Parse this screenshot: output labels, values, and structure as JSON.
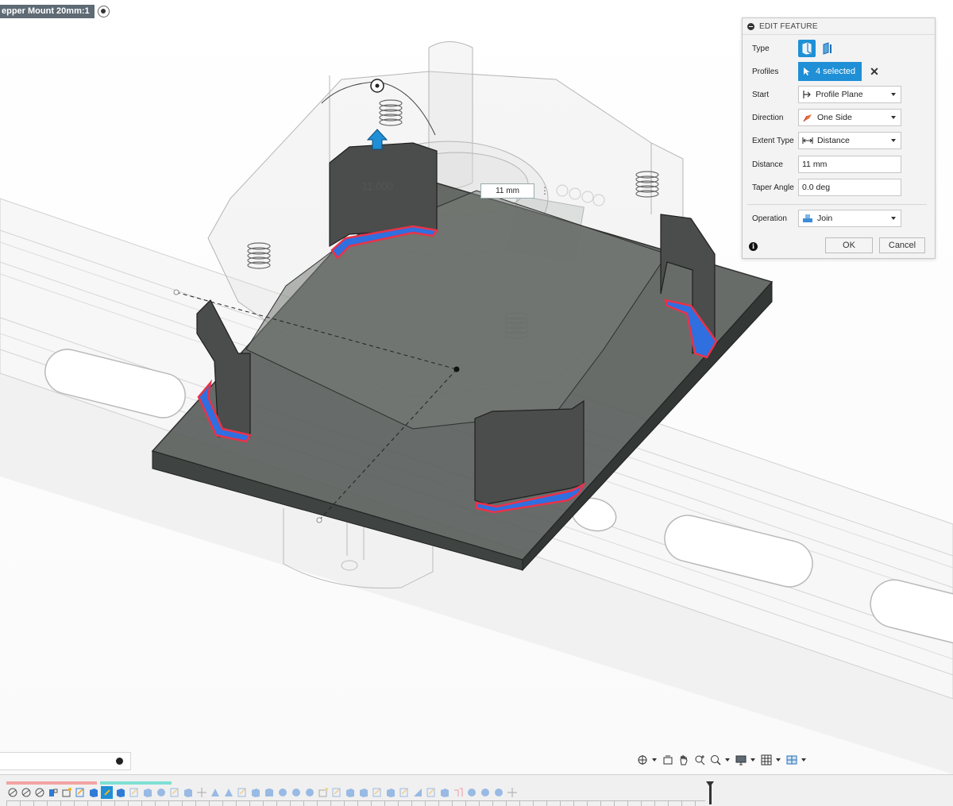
{
  "document": {
    "title": "epper Mount 20mm:1"
  },
  "viewport": {
    "dimension_label": "11.000",
    "dimension_input": "11 mm"
  },
  "edit_feature": {
    "title": "EDIT FEATURE",
    "rows": {
      "type": {
        "label": "Type"
      },
      "profiles": {
        "label": "Profiles",
        "value": "4 selected"
      },
      "start": {
        "label": "Start",
        "value": "Profile Plane"
      },
      "direction": {
        "label": "Direction",
        "value": "One Side"
      },
      "extent_type": {
        "label": "Extent Type",
        "value": "Distance"
      },
      "distance": {
        "label": "Distance",
        "value": "11 mm"
      },
      "taper_angle": {
        "label": "Taper Angle",
        "value": "0.0 deg"
      },
      "operation": {
        "label": "Operation",
        "value": "Join"
      }
    },
    "ok_label": "OK",
    "cancel_label": "Cancel"
  },
  "nav_toolbar": {
    "icons": [
      "orbit-icon",
      "look-at-icon",
      "pan-icon",
      "zoom-icon",
      "zoom-window-icon",
      "display-settings-icon",
      "grid-icon",
      "viewports-icon"
    ]
  },
  "colors": {
    "accent": "#1f8fd6",
    "profile_blue": "#2f6fe0",
    "profile_red": "#e8334a",
    "body_dark": "#4f5552"
  }
}
